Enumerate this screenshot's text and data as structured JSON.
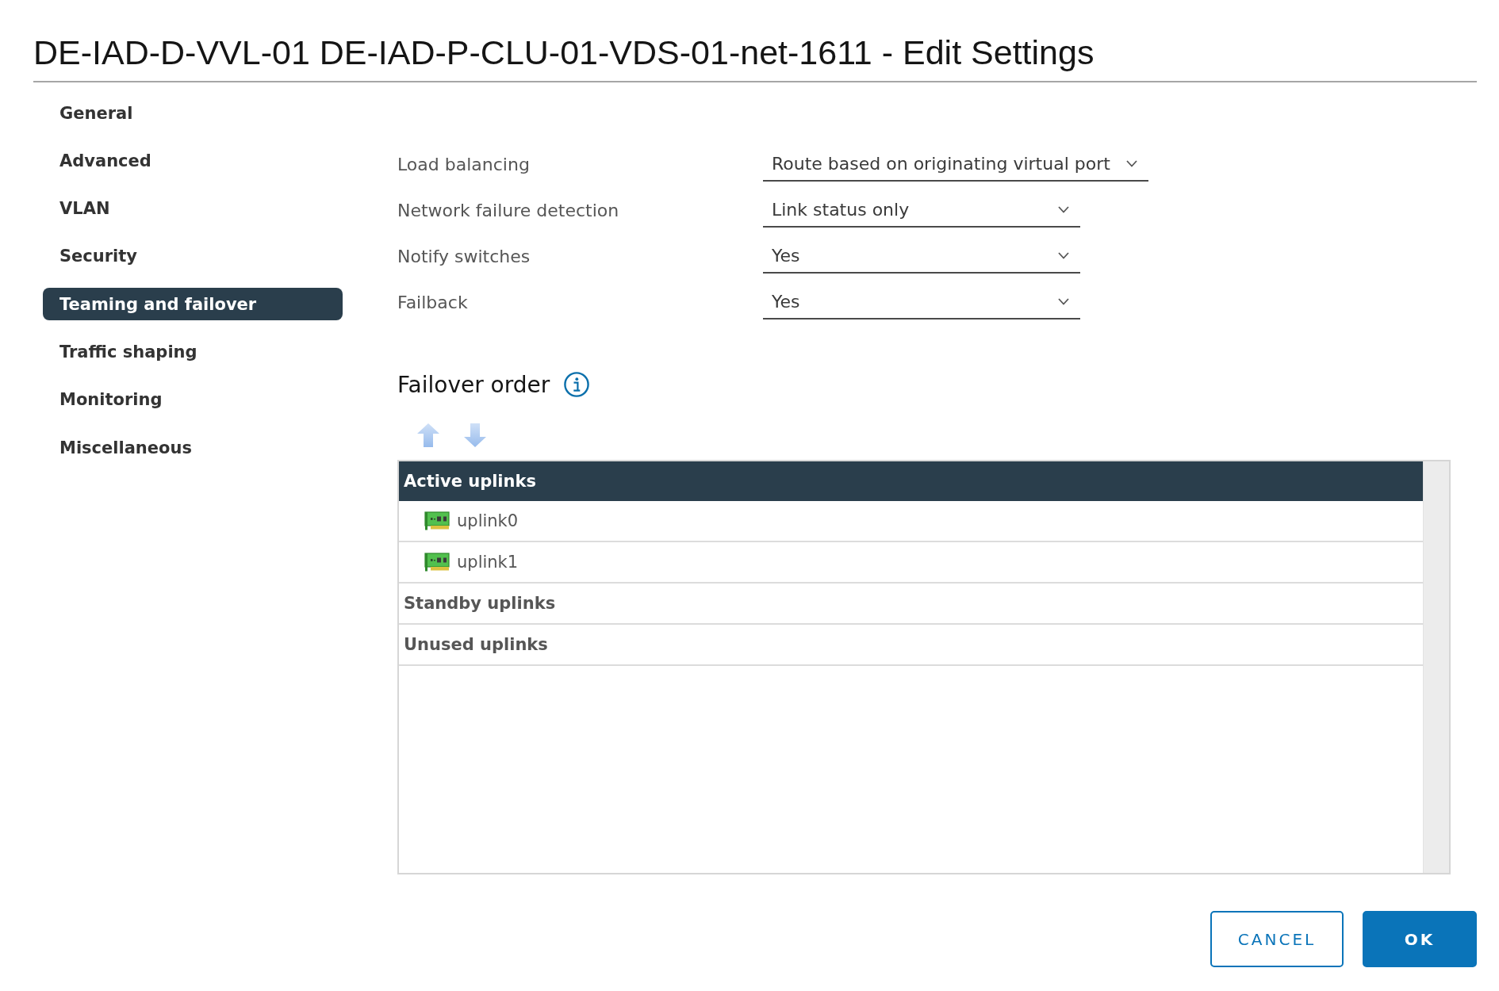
{
  "window": {
    "title": "DE-IAD-D-VVL-01 DE-IAD-P-CLU-01-VDS-01-net-1611 - Edit Settings"
  },
  "sidebar": {
    "items": [
      {
        "label": "General",
        "selected": false
      },
      {
        "label": "Advanced",
        "selected": false
      },
      {
        "label": "VLAN",
        "selected": false
      },
      {
        "label": "Security",
        "selected": false
      },
      {
        "label": "Teaming and failover",
        "selected": true
      },
      {
        "label": "Traffic shaping",
        "selected": false
      },
      {
        "label": "Monitoring",
        "selected": false
      },
      {
        "label": "Miscellaneous",
        "selected": false
      }
    ]
  },
  "settings": [
    {
      "label": "Load balancing",
      "value": "Route based on originating virtual port"
    },
    {
      "label": "Network failure detection",
      "value": "Link status only"
    },
    {
      "label": "Notify switches",
      "value": "Yes"
    },
    {
      "label": "Failback",
      "value": "Yes"
    }
  ],
  "failover_order": {
    "title": "Failover order",
    "move_buttons": [
      {
        "kind": "up",
        "disabled": true
      },
      {
        "kind": "down",
        "disabled": true
      }
    ],
    "groups": [
      {
        "label": "Active uplinks",
        "selected": true,
        "children": [
          {
            "label": "uplink0",
            "selected": false
          },
          {
            "label": "uplink1",
            "selected": false
          }
        ]
      },
      {
        "label": "Standby uplinks",
        "selected": false
      },
      {
        "label": "Unused uplinks",
        "selected": false
      }
    ]
  },
  "buttons": [
    {
      "label": "CANCEL",
      "kind": "outline"
    },
    {
      "label": "OK",
      "kind": "solid"
    }
  ]
}
